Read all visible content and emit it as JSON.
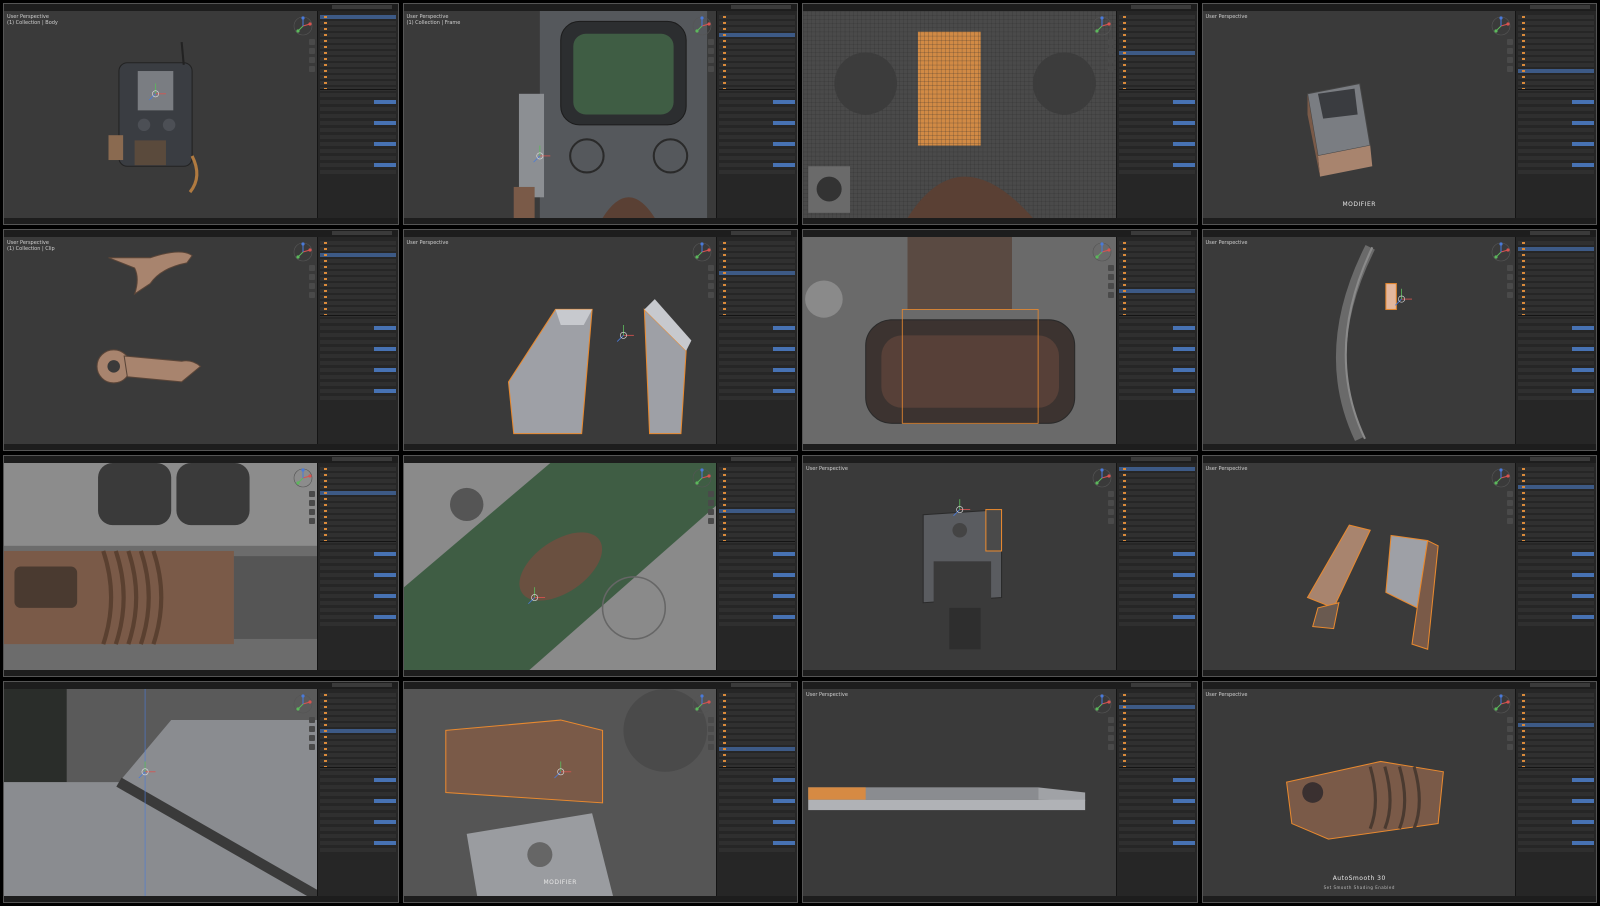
{
  "tiles": [
    {
      "id": "t1",
      "subject": "device-front",
      "vp_label": "User Perspective\n(1) Collection | Body"
    },
    {
      "id": "t2",
      "subject": "screen-closeup",
      "vp_label": "User Perspective\n(1) Collection | Frame"
    },
    {
      "id": "t3",
      "subject": "retopo-closeup",
      "vp_label": ""
    },
    {
      "id": "t4",
      "subject": "small-part",
      "vp_label": "User Perspective",
      "overlay": "MODIFIER"
    },
    {
      "id": "t5",
      "subject": "clip-pieces",
      "vp_label": "User Perspective\n(1) Collection | Clip"
    },
    {
      "id": "t6",
      "subject": "two-blocks",
      "vp_label": "User Perspective"
    },
    {
      "id": "t7",
      "subject": "cavity",
      "vp_label": ""
    },
    {
      "id": "t8",
      "subject": "curved-strip",
      "vp_label": "User Perspective"
    },
    {
      "id": "t9",
      "subject": "grip-closeup",
      "vp_label": ""
    },
    {
      "id": "t10",
      "subject": "tilted-panel",
      "vp_label": ""
    },
    {
      "id": "t11",
      "subject": "device-back",
      "vp_label": "User Perspective"
    },
    {
      "id": "t12",
      "subject": "bracket-pieces",
      "vp_label": "User Perspective"
    },
    {
      "id": "t13",
      "subject": "slope-closeup",
      "vp_label": ""
    },
    {
      "id": "t14",
      "subject": "assembly-angle",
      "vp_label": "",
      "overlay": "MODIFIER"
    },
    {
      "id": "t15",
      "subject": "flat-bar",
      "vp_label": "User Perspective"
    },
    {
      "id": "t16",
      "subject": "handle-part",
      "vp_label": "User Perspective",
      "overlay": "AutoSmooth 30",
      "overlay2": "Set Smooth Shading Enabled"
    }
  ],
  "colors": {
    "viewport": "#3a3a3a",
    "mesh_gray": "#6e6e6e",
    "mesh_dark": "#454545",
    "mesh_brown": "#7a5a48",
    "mesh_tan": "#a8846e",
    "selection": "#e8892f",
    "screen_green": "#3f5d44",
    "accent_blue": "#4772b3"
  }
}
